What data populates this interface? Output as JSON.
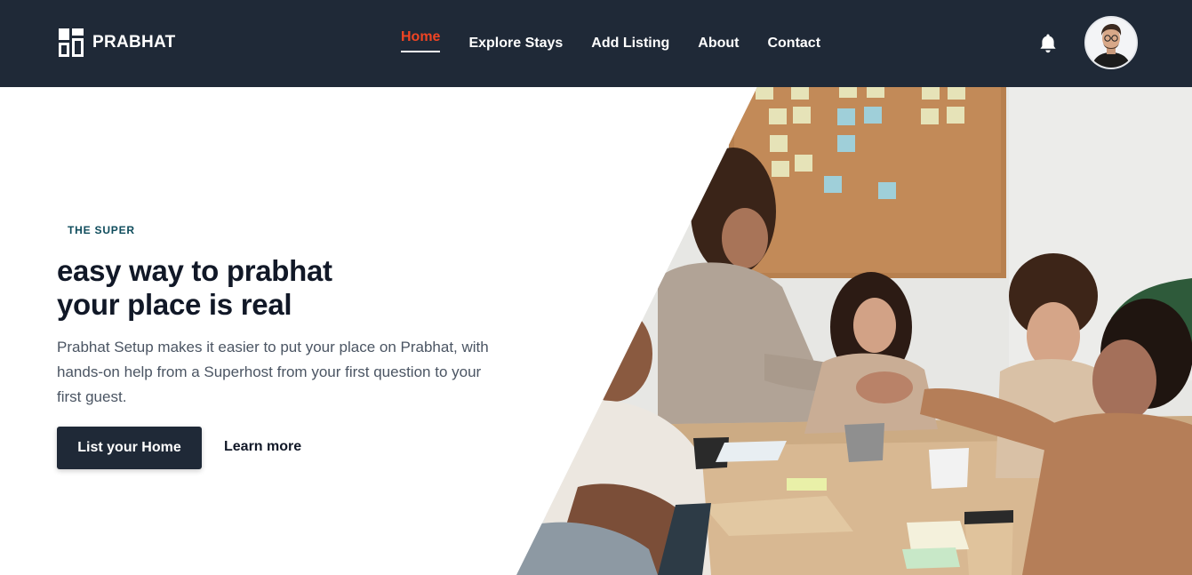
{
  "brand": {
    "name": "PRABHAT",
    "logo_icon": "prabhat-logo-icon"
  },
  "nav": {
    "links": [
      {
        "label": "Home",
        "active": true
      },
      {
        "label": "Explore Stays",
        "active": false
      },
      {
        "label": "Add Listing",
        "active": false
      },
      {
        "label": "About",
        "active": false
      },
      {
        "label": "Contact",
        "active": false
      }
    ],
    "notification_icon": "bell-icon",
    "avatar_icon": "user-avatar"
  },
  "hero": {
    "eyebrow": "THE SUPER",
    "headline_line1": "easy way to prabhat",
    "headline_line2": "your place is real",
    "description": "Prabhat Setup makes it easier to put your place on Prabhat, with hands-on help from a Superhost from your first question to your first guest.",
    "primary_button": "List your Home",
    "secondary_link": "Learn more",
    "image_subject": "team-meeting-handshake-photo"
  },
  "colors": {
    "nav_bg": "#1f2937",
    "accent": "#ef4423",
    "eyebrow": "#0f4c5c",
    "heading": "#111827",
    "body_text": "#4b5563"
  }
}
